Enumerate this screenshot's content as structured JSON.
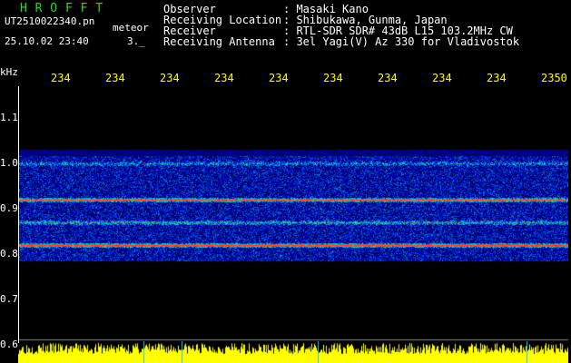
{
  "header": {
    "logo": "H R O F F T",
    "filename": "UT2510022340.pn",
    "meteor_label": "meteor",
    "datetime": "25.10.02 23:40",
    "mode": "3._",
    "fields": [
      {
        "key": "Observer",
        "value": ": Masaki Kano"
      },
      {
        "key": "Receiving Location",
        "value": ": Shibukawa, Gunma, Japan"
      },
      {
        "key": "Receiver",
        "value": ": RTL-SDR SDR# 43dB L15 103.2MHz CW"
      },
      {
        "key": "Receiving Antenna",
        "value": ": 3el Yagi(V) Az 330 for Vladivostok"
      }
    ]
  },
  "chart_data": {
    "type": "heatmap",
    "ylabel": "kHz",
    "x_ticks": [
      "234",
      "234",
      "234",
      "234",
      "234",
      "234",
      "234",
      "234",
      "234",
      "2350"
    ],
    "y_ticks": [
      "1.1",
      "1.0",
      "0.9",
      "0.8",
      "0.7",
      "0.6"
    ],
    "ylim": [
      0.6,
      1.1
    ],
    "bands_khz": [
      {
        "center": 0.92,
        "intensity": "high"
      },
      {
        "center": 0.82,
        "intensity": "very-high"
      },
      {
        "center": 0.87,
        "intensity": "medium"
      },
      {
        "center": 1.0,
        "intensity": "low"
      }
    ],
    "colors": {
      "background": "#000000",
      "noise": "#0010c0",
      "signal_mid": "#00c0ff",
      "signal_high": "#ff2020",
      "strip": "#ffff00"
    }
  }
}
